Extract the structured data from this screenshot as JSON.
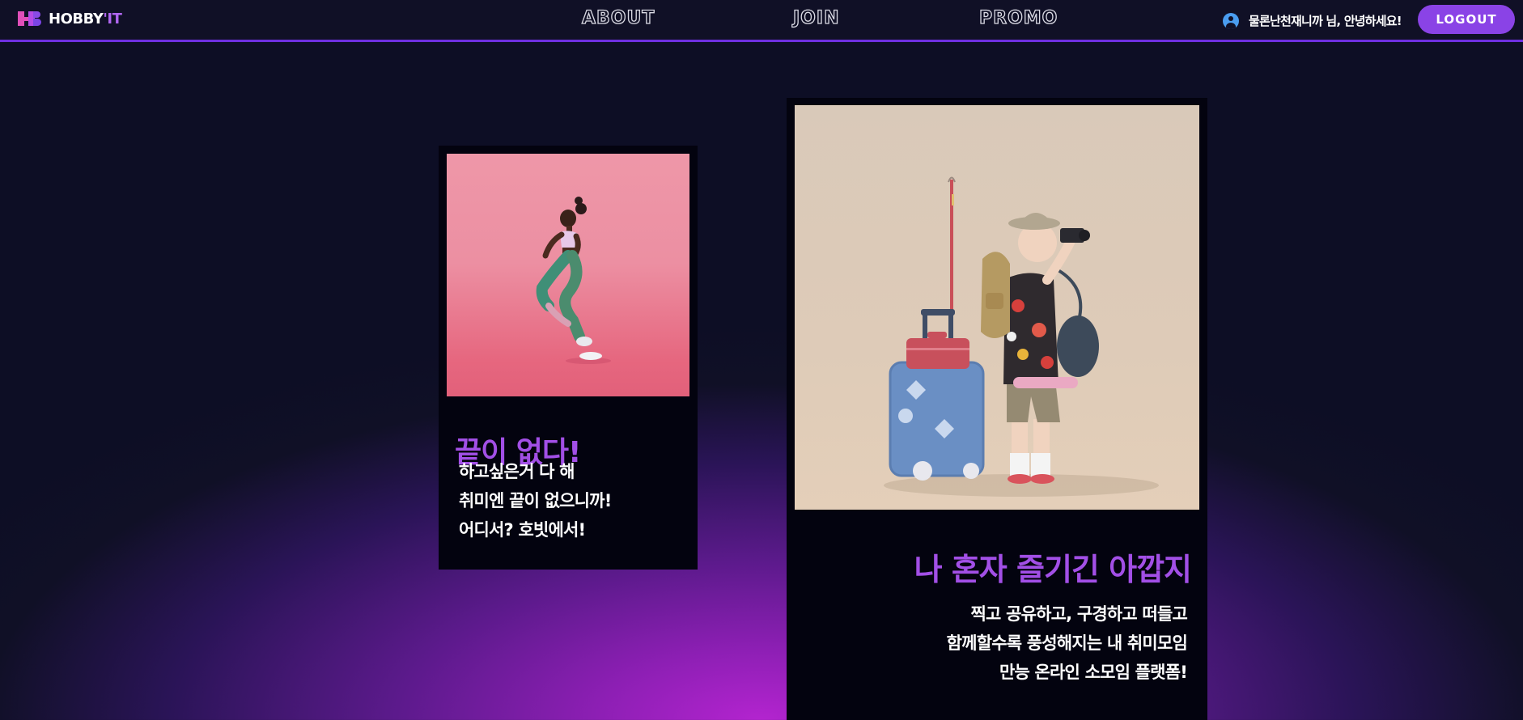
{
  "header": {
    "logo_text_main": "HOBBY",
    "logo_text_accent": "'IT",
    "nav": [
      {
        "label": "ABOUT"
      },
      {
        "label": "JOIN"
      },
      {
        "label": "PROMO"
      }
    ],
    "greeting": "물론난천재니까 님, 안녕하세요!",
    "logout_label": "LOGOUT",
    "user_icon": "account-circle-icon"
  },
  "cards": [
    {
      "image": "woman-running-3d-illustration",
      "title": "끝이 없다!",
      "lines": [
        "하고싶은거 다 해",
        "취미엔 끝이 없으니까!",
        "어디서? 호빗에서!"
      ]
    },
    {
      "image": "traveler-with-camera-3d-illustration",
      "title": "나 혼자 즐기긴 아깝지",
      "lines": [
        "찍고 공유하고, 구경하고 떠들고",
        "함께할수록 풍성해지는 내 취미모임",
        "만능 온라인 소모임 플랫폼!"
      ]
    }
  ],
  "colors": {
    "accent": "#8a43e6",
    "title_purple": "#a24fe6",
    "background": "#101026",
    "glow": "#b324cf"
  }
}
